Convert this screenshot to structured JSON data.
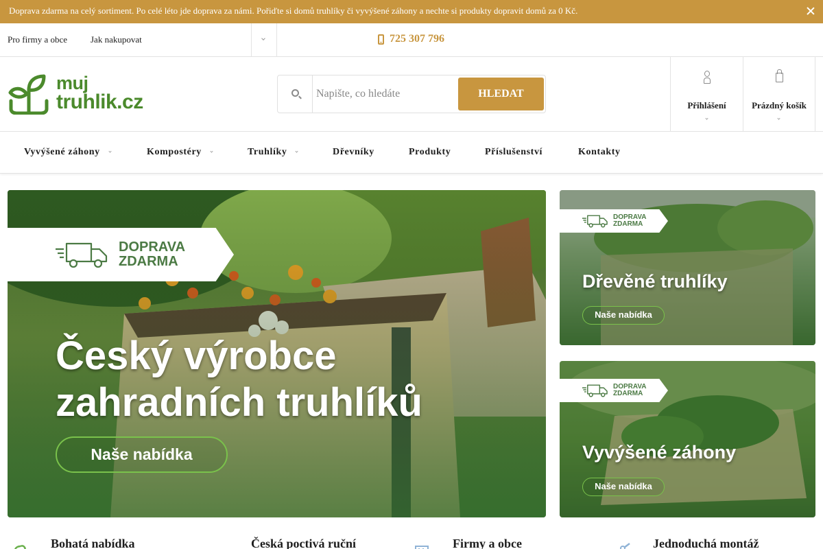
{
  "announcement": {
    "text": "Doprava zdarma na celý sortiment. Po celé léto jde doprava za námi. Pořiďte si domů truhlíky či vyvýšené záhony a nechte si produkty dopravit domů za 0 Kč."
  },
  "topbar": {
    "links": [
      "Pro firmy a obce",
      "Jak nakupovat"
    ],
    "phone": "725 307 796"
  },
  "header": {
    "logo_line1": "muj",
    "logo_line2": "truhlik.cz",
    "search_placeholder": "Napište, co hledáte",
    "search_button": "HLEDAT",
    "login_label": "Přihlášení",
    "cart_label": "Prázdný košík"
  },
  "nav": {
    "items": [
      "Vyvýšené záhony",
      "Kompostéry",
      "Truhlíky",
      "Dřevníky",
      "Produkty",
      "Příslušenství",
      "Kontakty"
    ]
  },
  "banners": {
    "main": {
      "ribbon_line1": "DOPRAVA",
      "ribbon_line2": "ZDARMA",
      "title_line1": "Český výrobce",
      "title_line2": "zahradních truhlíků",
      "button": "Naše nabídka"
    },
    "side1": {
      "ribbon_line1": "DOPRAVA",
      "ribbon_line2": "ZDARMA",
      "title": "Dřevěné truhlíky",
      "button": "Naše nabídka"
    },
    "side2": {
      "ribbon_line1": "DOPRAVA",
      "ribbon_line2": "ZDARMA",
      "title": "Vyvýšené záhony",
      "button": "Naše nabídka"
    }
  },
  "features": [
    "Bohatá nabídka",
    "Česká poctivá ruční",
    "Firmy a obce",
    "Jednoduchá montáž"
  ],
  "colors": {
    "accent": "#c8963f",
    "brand_green": "#4b8a2c",
    "button_border": "#7ac24b"
  }
}
